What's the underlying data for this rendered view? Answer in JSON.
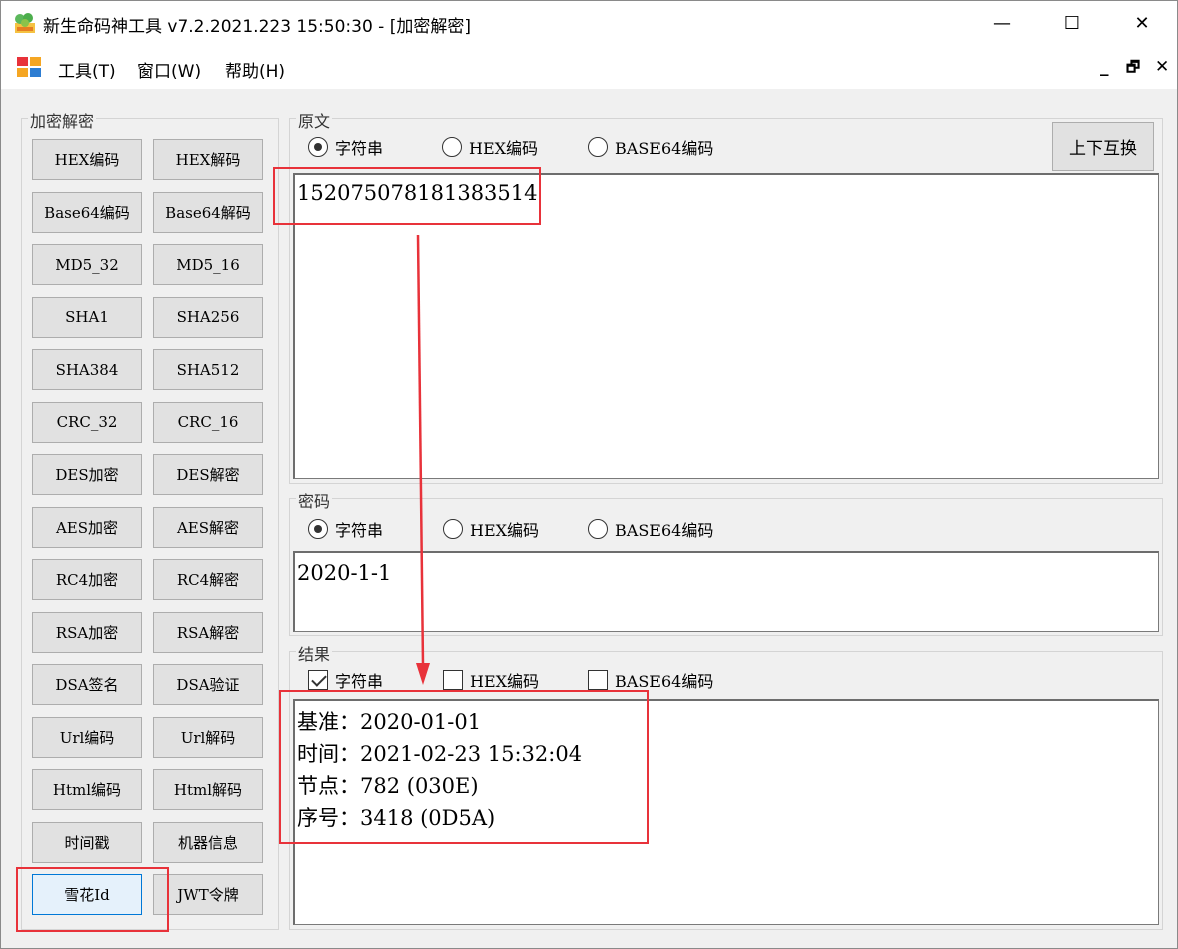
{
  "window": {
    "title": "新生命码神工具 v7.2.2021.223 15:50:30 - [加密解密]",
    "controls": {
      "minimize": "—",
      "maximize": "☐",
      "close": "✕"
    }
  },
  "menu": {
    "items": [
      "工具(T)",
      "窗口(W)",
      "帮助(H)"
    ],
    "mdi": {
      "minimize": "_",
      "restore": "🗗",
      "close": "✕"
    }
  },
  "left_panel": {
    "title": "加密解密",
    "buttons": [
      [
        "HEX编码",
        "HEX解码"
      ],
      [
        "Base64编码",
        "Base64解码"
      ],
      [
        "MD5_32",
        "MD5_16"
      ],
      [
        "SHA1",
        "SHA256"
      ],
      [
        "SHA384",
        "SHA512"
      ],
      [
        "CRC_32",
        "CRC_16"
      ],
      [
        "DES加密",
        "DES解密"
      ],
      [
        "AES加密",
        "AES解密"
      ],
      [
        "RC4加密",
        "RC4解密"
      ],
      [
        "RSA加密",
        "RSA解密"
      ],
      [
        "DSA签名",
        "DSA验证"
      ],
      [
        "Url编码",
        "Url解码"
      ],
      [
        "Html编码",
        "Html解码"
      ],
      [
        "时间戳",
        "机器信息"
      ],
      [
        "雪花Id",
        "JWT令牌"
      ]
    ],
    "active": "雪花Id"
  },
  "source": {
    "title": "原文",
    "options": [
      "字符串",
      "HEX编码",
      "BASE64编码"
    ],
    "selected": "字符串",
    "swap_label": "上下互换",
    "value": "152075078181383514"
  },
  "password": {
    "title": "密码",
    "options": [
      "字符串",
      "HEX编码",
      "BASE64编码"
    ],
    "selected": "字符串",
    "value": "2020-1-1"
  },
  "result": {
    "title": "结果",
    "options": [
      "字符串",
      "HEX编码",
      "BASE64编码"
    ],
    "checked": [
      true,
      false,
      false
    ],
    "lines": [
      "基准：2020-01-01",
      "时间：2021-02-23 15:32:04",
      "节点：782 (030E)",
      "序号：3418 (0D5A)"
    ]
  },
  "colors": {
    "highlight": "#e8323a",
    "active_button_border": "#0078d7"
  }
}
